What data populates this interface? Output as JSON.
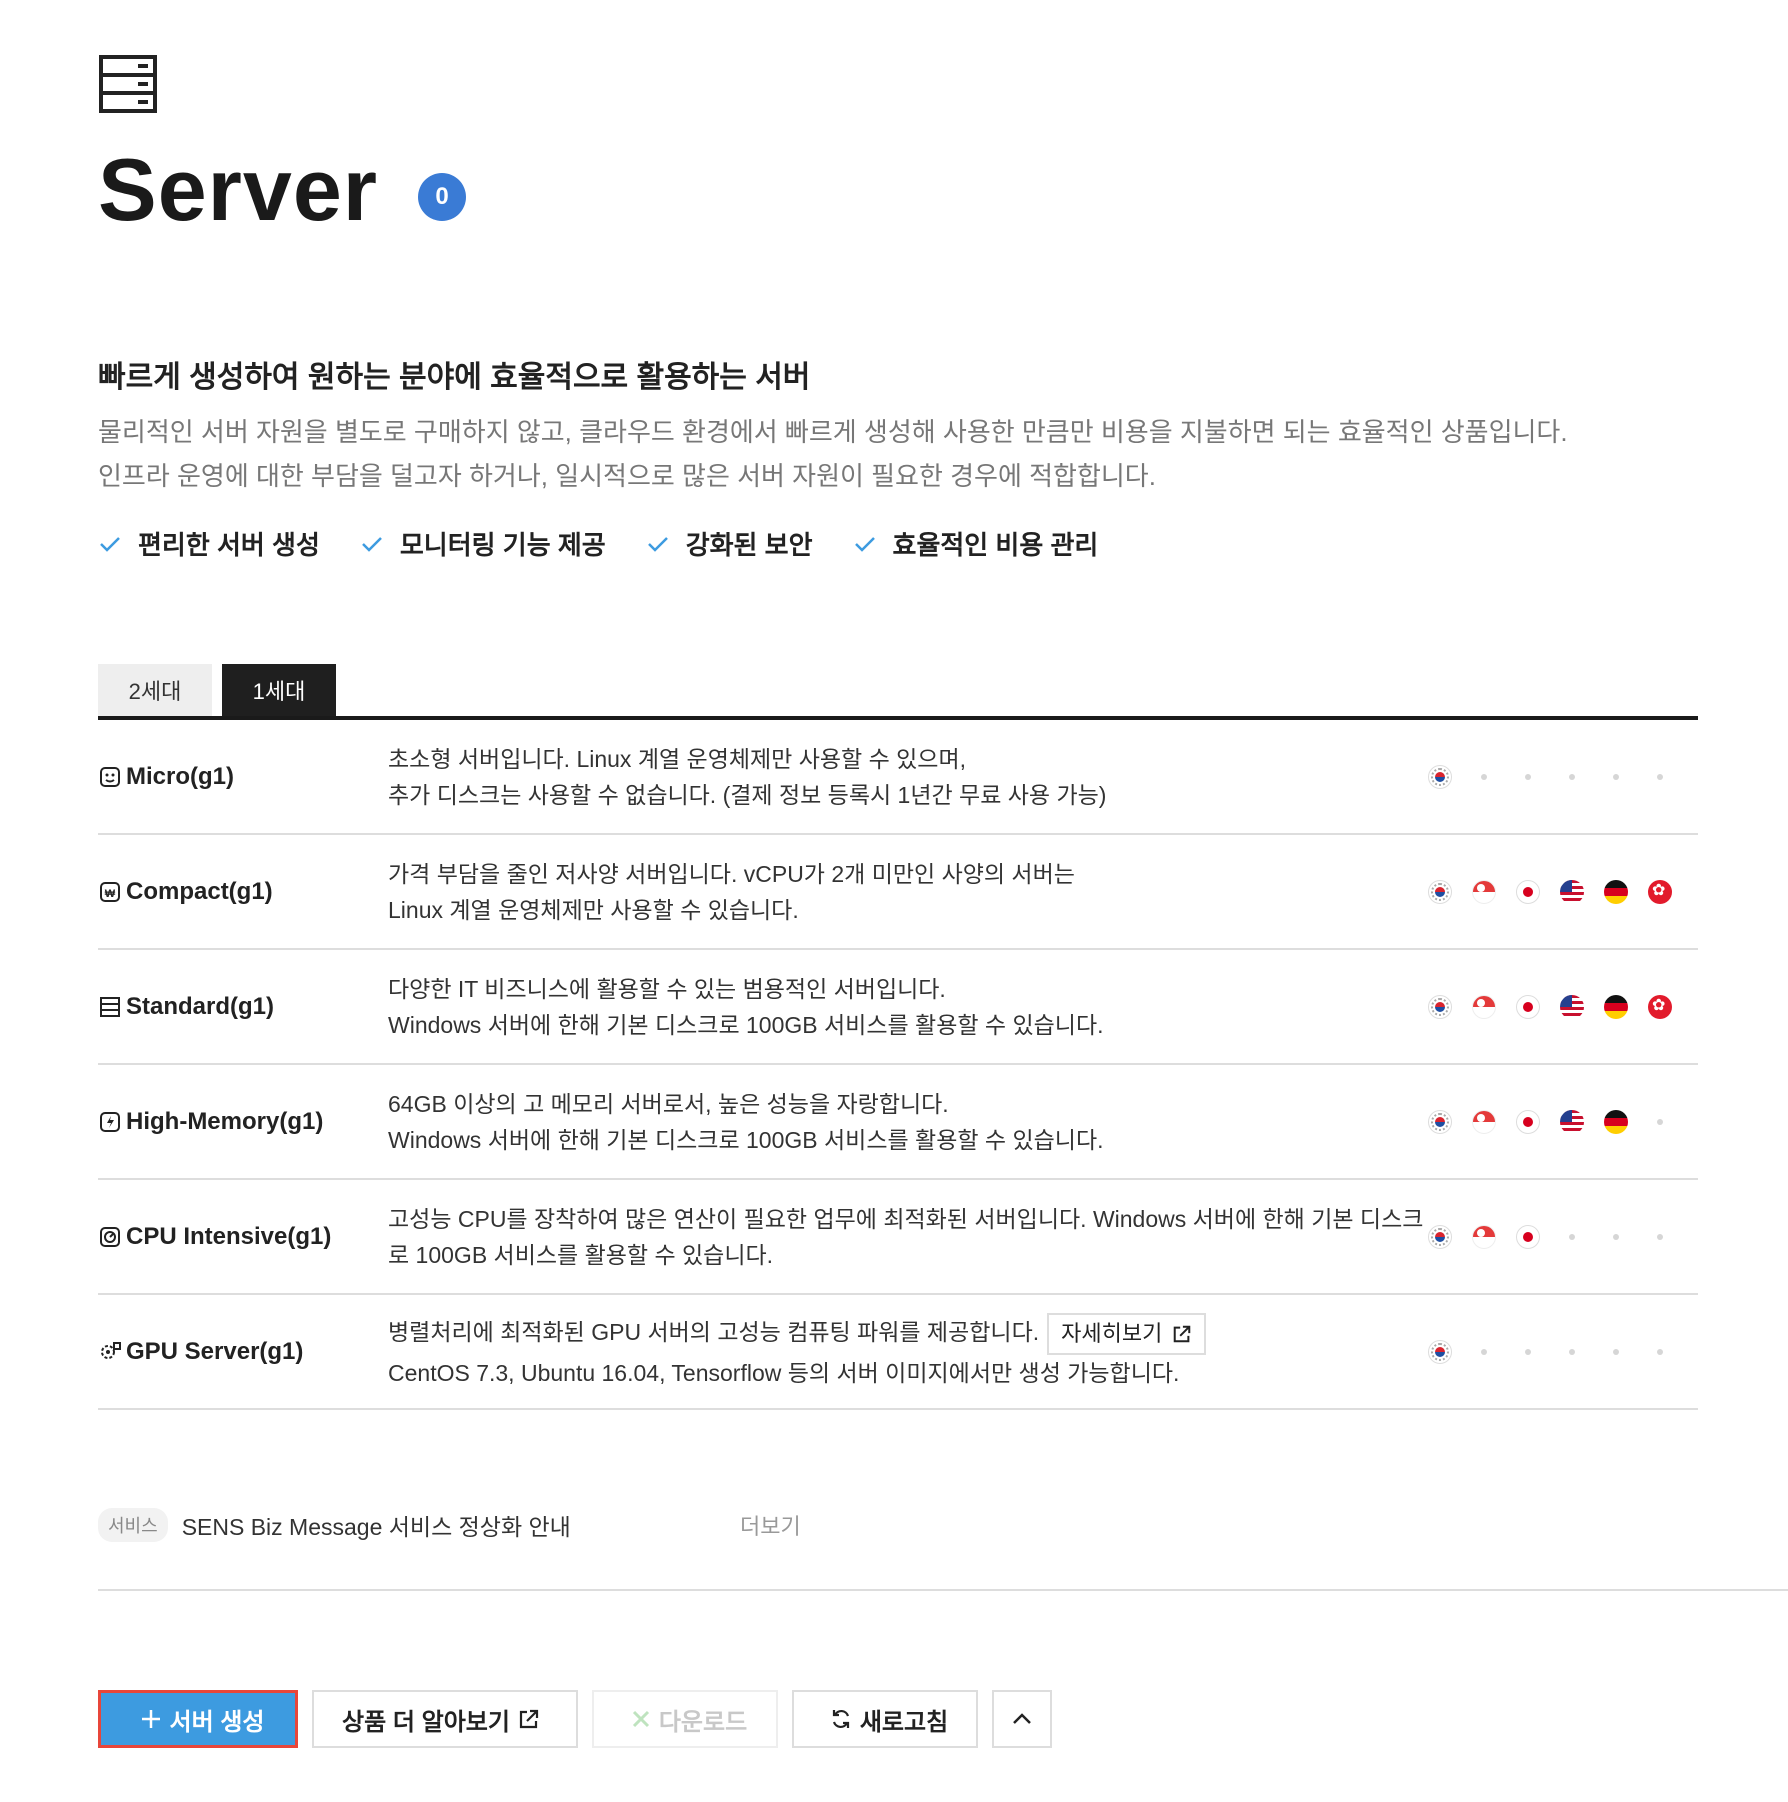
{
  "header": {
    "title": "Server",
    "count": "0",
    "icon": "server-rack-icon"
  },
  "intro": {
    "headline": "빠르게 생성하여 원하는 분야에 효율적으로 활용하는 서버",
    "desc_line1": "물리적인 서버 자원을 별도로 구매하지 않고, 클라우드 환경에서 빠르게 생성해 사용한 만큼만 비용을 지불하면 되는 효율적인 상품입니다.",
    "desc_line2": "인프라 운영에 대한 부담을 덜고자 하거나, 일시적으로 많은 서버 자원이 필요한 경우에 적합합니다.",
    "features": [
      "편리한 서버 생성",
      "모니터링 기능 제공",
      "강화된 보안",
      "효율적인 비용 관리"
    ]
  },
  "tabs": [
    {
      "label": "2세대",
      "active": false
    },
    {
      "label": "1세대",
      "active": true
    }
  ],
  "products": [
    {
      "name": "Micro(g1)",
      "icon": "micro-server-icon",
      "line1": "초소형 서버입니다. Linux 계열 운영체제만 사용할 수 있으며,",
      "line2": "추가 디스크는 사용할 수 없습니다. (결제 정보 등록시 1년간 무료 사용 가능)",
      "regions": [
        "kr",
        "",
        "",
        "",
        "",
        ""
      ]
    },
    {
      "name": "Compact(g1)",
      "icon": "compact-server-icon",
      "line1": "가격 부담을 줄인 저사양 서버입니다. vCPU가 2개 미만인 사양의 서버는",
      "line2": "Linux 계열 운영체제만 사용할 수 있습니다.",
      "regions": [
        "kr",
        "sg",
        "jp",
        "us",
        "de",
        "hk"
      ]
    },
    {
      "name": "Standard(g1)",
      "icon": "standard-server-icon",
      "line1": "다양한 IT 비즈니스에 활용할 수 있는 범용적인 서버입니다.",
      "line2": "Windows 서버에 한해 기본 디스크로 100GB 서비스를 활용할 수 있습니다.",
      "regions": [
        "kr",
        "sg",
        "jp",
        "us",
        "de",
        "hk"
      ]
    },
    {
      "name": "High-Memory(g1)",
      "icon": "high-memory-server-icon",
      "line1": "64GB 이상의 고 메모리 서버로서, 높은 성능을 자랑합니다.",
      "line2": "Windows 서버에 한해 기본 디스크로 100GB 서비스를 활용할 수 있습니다.",
      "regions": [
        "kr",
        "sg",
        "jp",
        "us",
        "de",
        ""
      ]
    },
    {
      "name": "CPU Intensive(g1)",
      "icon": "cpu-intensive-server-icon",
      "line1": "고성능 CPU를 장착하여 많은 연산이 필요한 업무에 최적화된 서버입니다. Windows 서버에 한해 기본 디스크",
      "line2": "로 100GB 서비스를 활용할 수 있습니다.",
      "regions": [
        "kr",
        "sg",
        "jp",
        "",
        "",
        ""
      ]
    },
    {
      "name": "GPU Server(g1)",
      "icon": "gpu-server-icon",
      "line1": "병렬처리에 최적화된 GPU 서버의 고성능 컴퓨팅 파워를 제공합니다.",
      "line2": "CentOS 7.3, Ubuntu 16.04, Tensorflow 등의 서버 이미지에서만 생성 가능합니다.",
      "detail_label": "자세히보기",
      "regions": [
        "kr",
        "",
        "",
        "",
        "",
        ""
      ]
    }
  ],
  "notice": {
    "tag": "서비스",
    "message": "SENS Biz Message 서비스 정상화 안내",
    "more": "더보기"
  },
  "actions": {
    "create": "서버 생성",
    "learn_more": "상품 더 알아보기",
    "download": "다운로드",
    "refresh": "새로고침"
  },
  "colors": {
    "accent": "#3d9be0",
    "badge": "#3a7bd5",
    "highlight_border": "#e8463a",
    "check": "#3d9be0"
  }
}
